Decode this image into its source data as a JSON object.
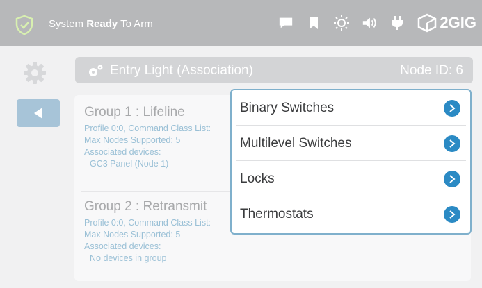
{
  "status_bar": {
    "status_prefix": "System ",
    "status_bold": "Ready",
    "status_suffix": " To Arm",
    "brand": "2GIG",
    "icons": [
      "shield-check-icon",
      "message-icon",
      "bookmark-icon",
      "brightness-icon",
      "volume-icon",
      "power-plug-icon",
      "2gig-logo-icon"
    ]
  },
  "left_nav": {
    "icons": [
      "gear-icon",
      "back-arrow-icon"
    ]
  },
  "header": {
    "icon": "devices-icon",
    "title": "Entry Light (Association)",
    "node_id": "Node ID: 6"
  },
  "groups": [
    {
      "title": "Group 1 : Lifeline",
      "profile": "Profile 0:0, Command Class List:",
      "max_nodes": "Max Nodes Supported: 5",
      "assoc_label": "Associated devices:",
      "assoc_value": "GC3 Panel (Node 1)"
    },
    {
      "title": "Group 2 : Retransmit",
      "profile": "Profile 0:0, Command Class List:",
      "max_nodes": "Max Nodes Supported: 5",
      "assoc_label": "Associated devices:",
      "assoc_value": "No devices in group"
    }
  ],
  "popup": {
    "items": [
      {
        "label": "Binary Switches"
      },
      {
        "label": "Multilevel Switches"
      },
      {
        "label": "Locks"
      },
      {
        "label": "Thermostats"
      }
    ]
  },
  "colors": {
    "topbar": "#b7b8ba",
    "accent_blue": "#2b8ac4",
    "light_blue_text": "#9ac0d6",
    "back_button": "#a7c4d8"
  }
}
